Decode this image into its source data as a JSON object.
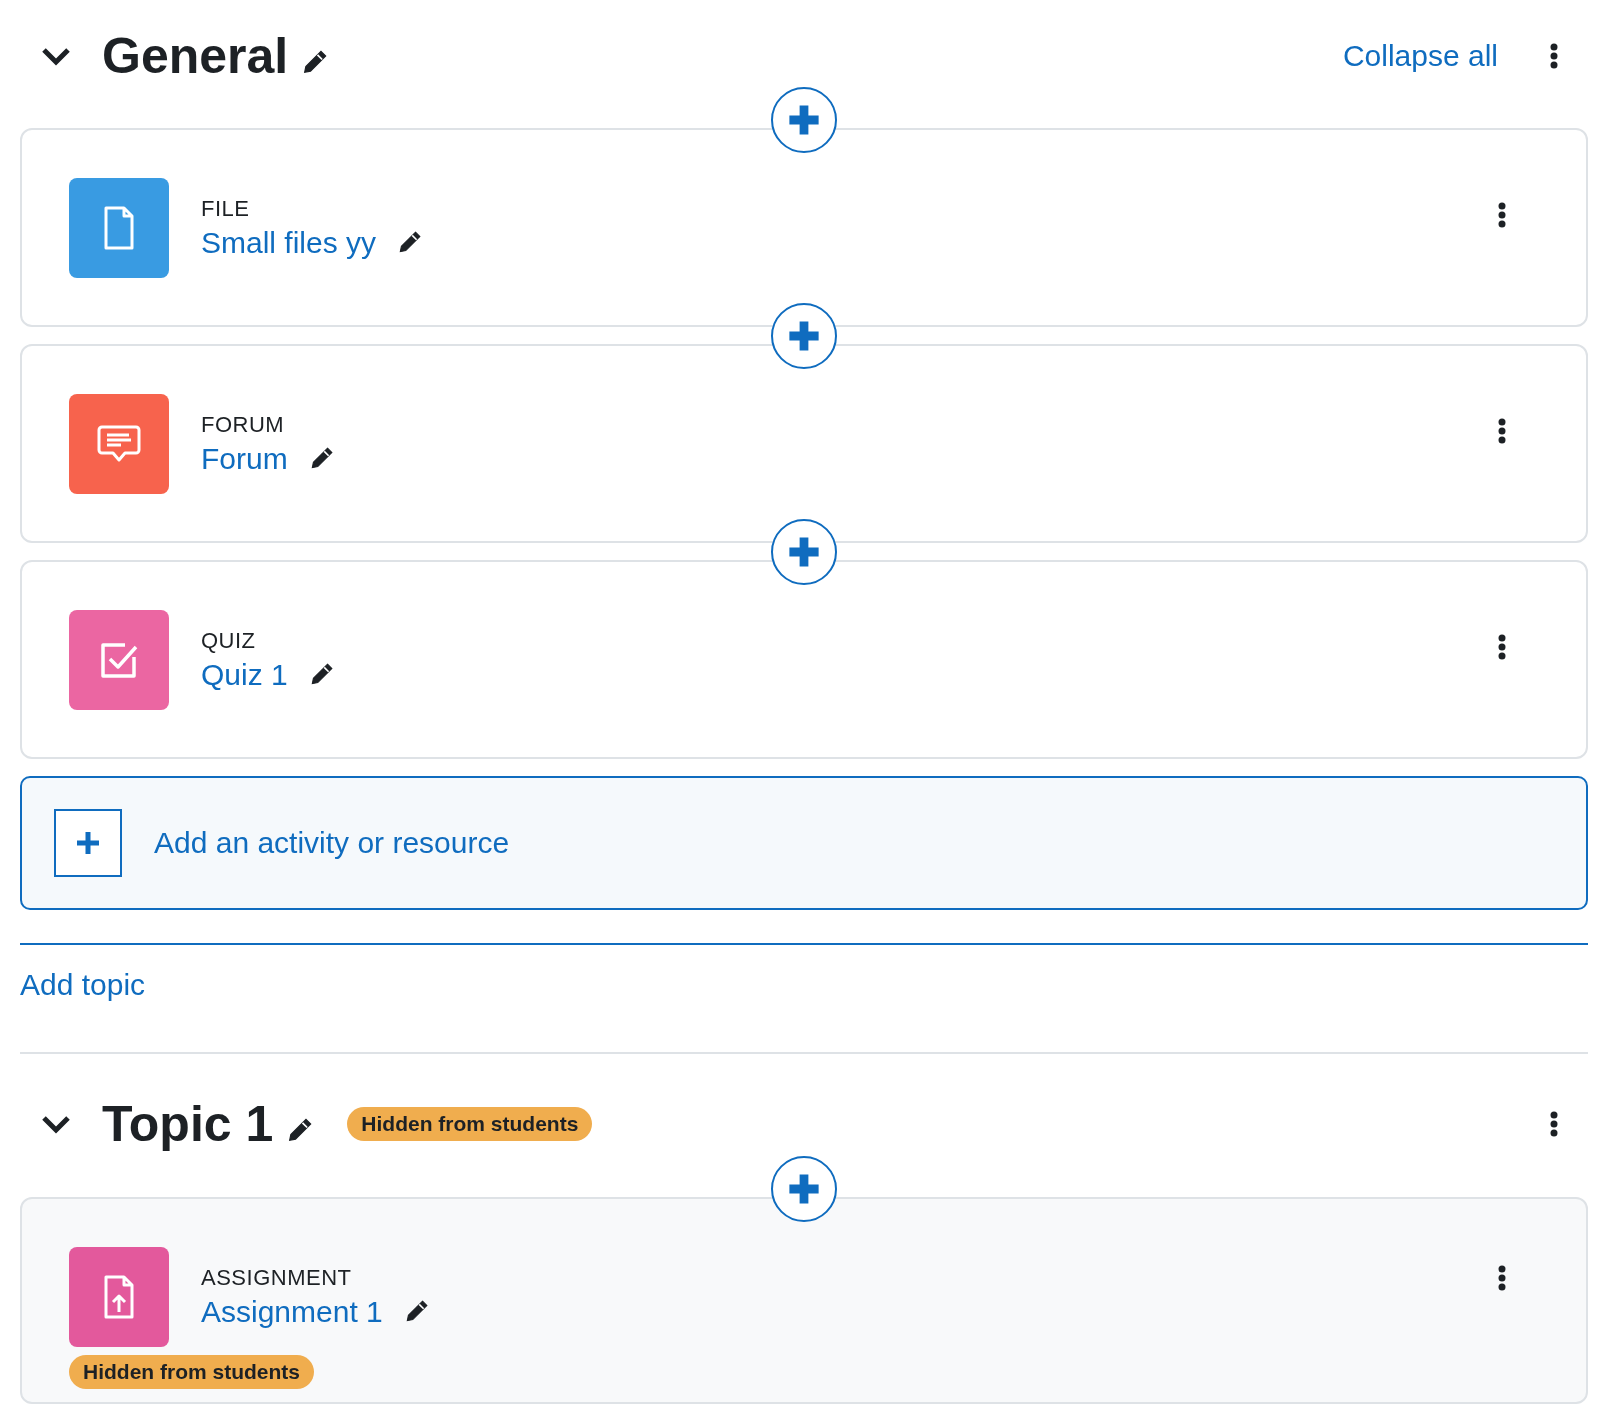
{
  "sections": [
    {
      "title": "General",
      "expanded": true,
      "collapse_all": "Collapse all",
      "activities": [
        {
          "kind": "file",
          "type": "FILE",
          "name": "Small files yy",
          "hidden": false
        },
        {
          "kind": "forum",
          "type": "FORUM",
          "name": "Forum",
          "hidden": false
        },
        {
          "kind": "quiz",
          "type": "QUIZ",
          "name": "Quiz 1",
          "hidden": false
        }
      ],
      "add_activity": "Add an activity or resource",
      "add_topic": "Add topic"
    },
    {
      "title": "Topic 1",
      "expanded": true,
      "badge": "Hidden from students",
      "activities": [
        {
          "kind": "assignment",
          "type": "ASSIGNMENT",
          "name": "Assignment 1",
          "hidden": true,
          "badge": "Hidden from students"
        }
      ]
    }
  ]
}
